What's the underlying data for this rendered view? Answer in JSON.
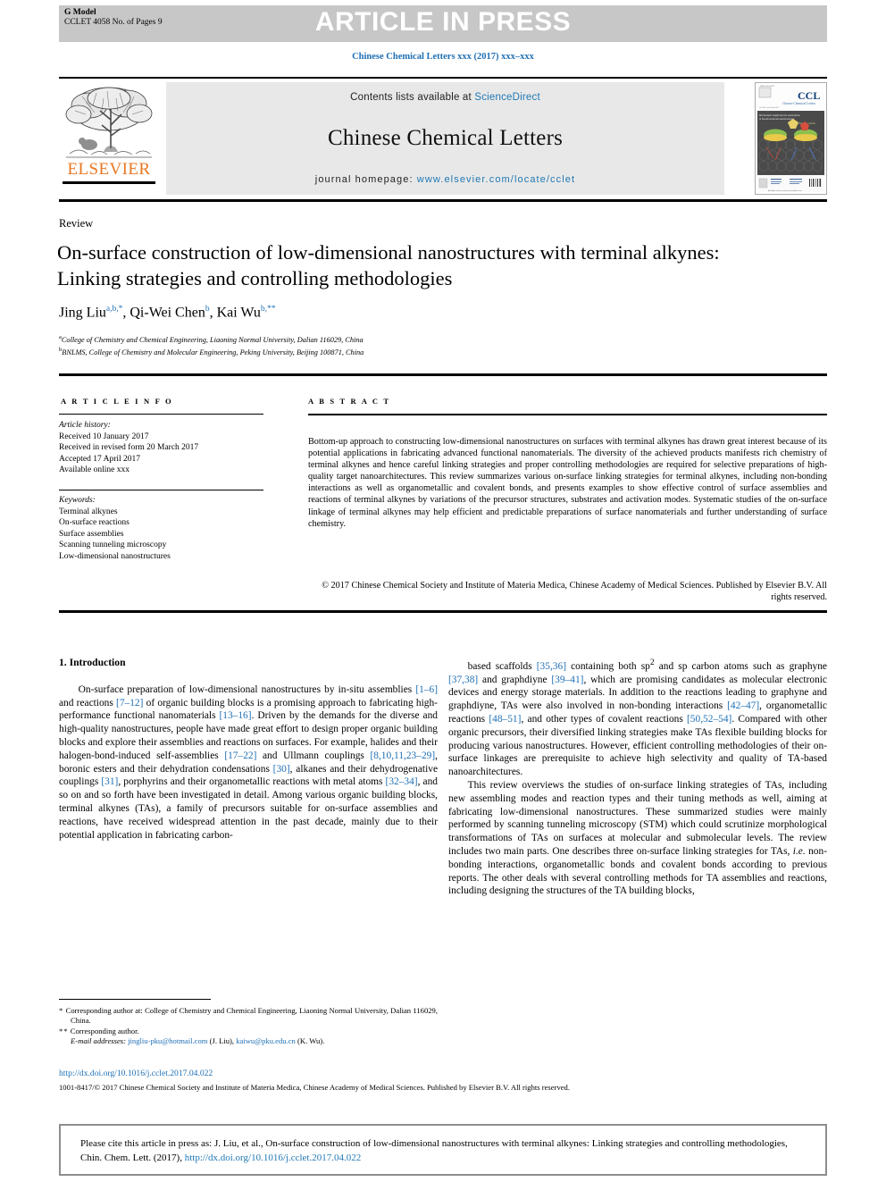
{
  "banner": {
    "gmodel_label": "G Model",
    "gmodel_sub": "CCLET 4058 No. of Pages 9",
    "status": "ARTICLE IN PRESS",
    "journal_ref": "Chinese Chemical Letters xxx (2017) xxx–xxx"
  },
  "masthead": {
    "contents_prefix": "Contents lists available at ",
    "sciencedirect": "ScienceDirect",
    "journal_title": "Chinese Chemical Letters",
    "homepage_prefix": "journal homepage: ",
    "homepage_url": "www.elsevier.com/locate/cclet",
    "publisher_wordmark": "ELSEVIER",
    "cover_title": "CCL",
    "cover_subtitle": "Chinese Chemical Letters"
  },
  "article": {
    "section_type": "Review",
    "title": "On-surface construction of low-dimensional nanostructures with terminal alkynes: Linking strategies and controlling methodologies",
    "authors_html": "Jing Liu<sup>a,b,*</sup>, Qi-Wei Chen<sup>b</sup>, Kai Wu<sup>b,**</sup>",
    "affiliation_a": "College of Chemistry and Chemical Engineering, Liaoning Normal University, Dalian 116029, China",
    "affiliation_b": "BNLMS, College of Chemistry and Molecular Engineering, Peking University, Beijing 100871, China"
  },
  "article_info": {
    "heading": "A R T I C L E   I N F O",
    "history_label": "Article history:",
    "history": [
      "Received 10 January 2017",
      "Received in revised form 20 March 2017",
      "Accepted 17 April 2017",
      "Available online xxx"
    ],
    "keywords_label": "Keywords:",
    "keywords": [
      "Terminal alkynes",
      "On-surface reactions",
      "Surface assemblies",
      "Scanning tunneling microscopy",
      "Low-dimensional nanostructures"
    ]
  },
  "abstract": {
    "heading": "A B S T R A C T",
    "body": "Bottom-up approach to constructing low-dimensional nanostructures on surfaces with terminal alkynes has drawn great interest because of its potential applications in fabricating advanced functional nanomaterials. The diversity of the achieved products manifests rich chemistry of terminal alkynes and hence careful linking strategies and proper controlling methodologies are required for selective preparations of high-quality target nanoarchitectures. This review summarizes various on-surface linking strategies for terminal alkynes, including non-bonding interactions as well as organometallic and covalent bonds, and presents examples to show effective control of surface assemblies and reactions of terminal alkynes by variations of the precursor structures, substrates and activation modes. Systematic studies of the on-surface linkage of terminal alkynes may help efficient and predictable preparations of surface nanomaterials and further understanding of surface chemistry.",
    "copyright": "© 2017 Chinese Chemical Society and Institute of Materia Medica, Chinese Academy of Medical Sciences. Published by Elsevier B.V. All rights reserved."
  },
  "body": {
    "section_heading": "1. Introduction",
    "left_paragraph_1_html": "On-surface preparation of low-dimensional nanostructures by in-situ assemblies <span class=\"ref\">[1–6]</span> and reactions <span class=\"ref\">[7–12]</span> of organic building blocks is a promising approach to fabricating high-performance functional nanomaterials <span class=\"ref\">[13–16]</span>. Driven by the demands for the diverse and high-quality nanostructures, people have made great effort to design proper organic building blocks and explore their assemblies and reactions on surfaces. For example, halides and their halogen-bond-induced self-assemblies <span class=\"ref\">[17–22]</span> and Ullmann couplings <span class=\"ref\">[8,10,11,23–29]</span>, boronic esters and their dehydration condensations <span class=\"ref\">[30]</span>, alkanes and their dehydrogenative couplings <span class=\"ref\">[31]</span>, porphyrins and their organometallic reactions with metal atoms <span class=\"ref\">[32–34]</span>, and so on and so forth have been investigated in detail. Among various organic building blocks, terminal alkynes (TAs), a family of precursors suitable for on-surface assemblies and reactions, have received widespread attention in the past decade, mainly due to their potential application in fabricating carbon-",
    "right_paragraph_1_html": "based scaffolds <span class=\"ref\">[35,36]</span> containing both sp<sup>2</sup> and sp carbon atoms such as graphyne <span class=\"ref\">[37,38]</span> and graphdiyne <span class=\"ref\">[39–41]</span>, which are promising candidates as molecular electronic devices and energy storage materials. In addition to the reactions leading to graphyne and graphdiyne, TAs were also involved in non-bonding interactions <span class=\"ref\">[42–47]</span>, organometallic reactions <span class=\"ref\">[48–51]</span>, and other types of covalent reactions <span class=\"ref\">[50,52–54]</span>. Compared with other organic precursors, their diversified linking strategies make TAs flexible building blocks for producing various nanostructures. However, efficient controlling methodologies of their on-surface linkages are prerequisite to achieve high selectivity and quality of TA-based nanoarchitectures.",
    "right_paragraph_2_html": "This review overviews the studies of on-surface linking strategies of TAs, including new assembling modes and reaction types and their tuning methods as well, aiming at fabricating low-dimensional nanostructures. These summarized studies were mainly performed by scanning tunneling microscopy (STM) which could scrutinize morphological transformations of TAs on surfaces at molecular and submolecular levels. The review includes two main parts. One describes three on-surface linking strategies for TAs, <i>i.e.</i> non-bonding interactions, organometallic bonds and covalent bonds according to previous reports. The other deals with several controlling methods for TA assemblies and reactions, including designing the structures of the TA building blocks,"
  },
  "footnotes": {
    "corr_1_html": "<span class=\"star\">*</span> Corresponding author at: College of Chemistry and Chemical Engineering, Liaoning Normal University, Dalian 116029, China.",
    "corr_2_html": "<span class=\"star\">**</span> Corresponding author.",
    "email_label": "E-mail addresses:",
    "email_1": "jingliu-pku@hotmail.com",
    "email_1_owner": "(J. Liu),",
    "email_2": "kaiwu@pku.edu.cn",
    "email_2_owner": "(K. Wu).",
    "doi": "http://dx.doi.org/10.1016/j.cclet.2017.04.022",
    "issn_line": "1001-8417/© 2017 Chinese Chemical Society and Institute of Materia Medica, Chinese Academy of Medical Sciences. Published by Elsevier B.V. All rights reserved."
  },
  "citation": {
    "text_prefix": "Please cite this article in press as: J. Liu, et al., On-surface construction of low-dimensional nanostructures with terminal alkynes: Linking strategies and controlling methodologies, Chin. Chem. Lett. (2017), ",
    "link": "http://dx.doi.org/10.1016/j.cclet.2017.04.022"
  },
  "colors": {
    "banner_gray": "#c7c7c7",
    "masthead_gray": "#e8e8e8",
    "link_blue": "#1f78b4",
    "ref_blue": "#1f6fb4",
    "elsevier_orange": "#E87722",
    "citebox_border": "#8d8d8d"
  }
}
